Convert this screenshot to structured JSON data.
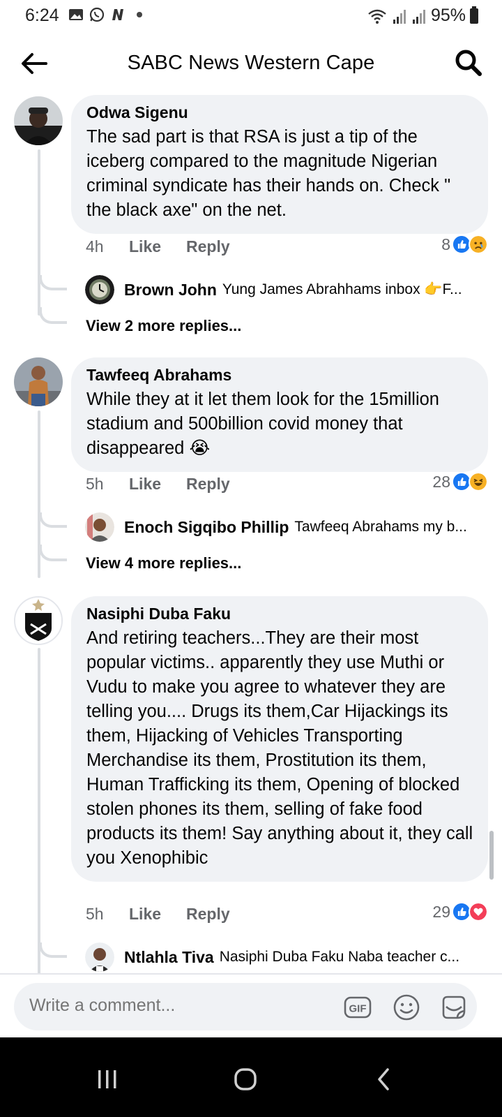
{
  "status_bar": {
    "time": "6:24",
    "battery": "95%"
  },
  "header": {
    "title": "SABC News Western Cape"
  },
  "comments": [
    {
      "author": "Odwa Sigenu",
      "text": "The sad part is that RSA is just a tip of the iceberg compared to the magnitude Nigerian criminal syndicate has their hands on. Check   \" the black axe\" on the net.",
      "time": "4h",
      "like_label": "Like",
      "reply_label": "Reply",
      "reaction_count": "8",
      "reactions": [
        "like",
        "sad"
      ],
      "reply_preview": {
        "author": "Brown John",
        "text": "Yung James Abrahhams inbox 👉F..."
      },
      "view_more": "View 2 more replies..."
    },
    {
      "author": "Tawfeeq Abrahams",
      "text": "While they at it let them look for the 15million stadium and 500billion covid money that disappeared 😭",
      "time": "5h",
      "like_label": "Like",
      "reply_label": "Reply",
      "reaction_count": "28",
      "reactions": [
        "like",
        "haha"
      ],
      "reply_preview": {
        "author": "Enoch Sigqibo Phillip",
        "text": "Tawfeeq Abrahams my b..."
      },
      "view_more": "View 4 more replies..."
    },
    {
      "author": "Nasiphi Duba Faku",
      "text": "And retiring teachers...They are their most popular victims.. apparently they use Muthi or Vudu to make you agree to whatever they are telling you.... Drugs its them,Car Hijackings its them, Hijacking of Vehicles Transporting Merchandise its them, Prostitution its them, Human Trafficking its them, Opening of blocked stolen phones its them, selling of fake food products its them! Say anything about it, they call you Xenophibic",
      "time": "5h",
      "like_label": "Like",
      "reply_label": "Reply",
      "reaction_count": "29",
      "reactions": [
        "like",
        "love"
      ],
      "reply_preview": {
        "author": "Ntlahla Tiva",
        "text": "Nasiphi Duba Faku Naba teacher c..."
      }
    }
  ],
  "composer": {
    "placeholder": "Write a comment...",
    "gif_label": "GIF"
  },
  "colors": {
    "accent": "#1877f2",
    "bubble": "#f0f2f5",
    "secondary_text": "#65676b",
    "love": "#f33e58",
    "haha": "#f7b125"
  }
}
